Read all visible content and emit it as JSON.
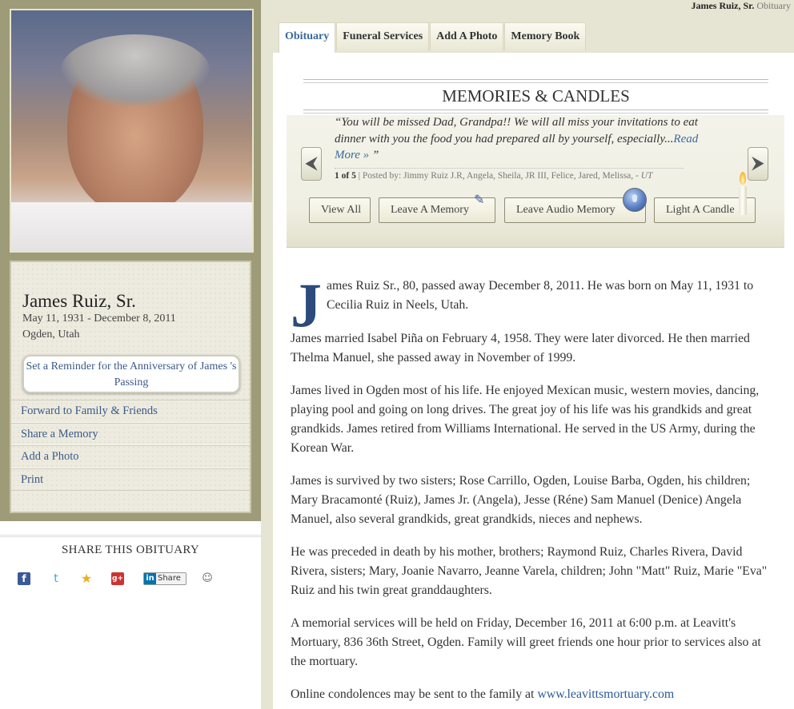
{
  "page": {
    "header_name": "James Ruiz, Sr.",
    "header_suffix": "Obituary"
  },
  "tabs": [
    {
      "label": "Obituary",
      "active": true
    },
    {
      "label": "Funeral Services",
      "active": false
    },
    {
      "label": "Add A Photo",
      "active": false
    },
    {
      "label": "Memory Book",
      "active": false
    }
  ],
  "profile": {
    "name": "James Ruiz, Sr.",
    "dates": "May 11, 1931 - December 8, 2011",
    "location": "Ogden, Utah",
    "reminder_label": "Set a Reminder for the Anniversary of James 's Passing"
  },
  "sidebar": {
    "links": [
      {
        "label": "Forward to Family & Friends"
      },
      {
        "label": "Share a Memory"
      },
      {
        "label": "Add a Photo"
      },
      {
        "label": "Print"
      }
    ]
  },
  "share": {
    "title": "SHARE THIS OBITUARY",
    "icons": [
      "facebook-icon",
      "twitter-icon",
      "favorite-star-icon",
      "google-plus-icon",
      "linkedin-share-icon",
      "reddit-icon"
    ],
    "linkedin_label": "Share",
    "fb_glyph": "f",
    "twitter_glyph": "t",
    "star_glyph": "★",
    "gplus_glyph": "g+",
    "linkedin_glyph": "in",
    "reddit_glyph": "☺"
  },
  "memories": {
    "title": "MEMORIES & CANDLES",
    "quote": "“You will be missed Dad, Grandpa!! We will all miss your invitations to eat dinner with you the food you had prepared all by yourself, especially...",
    "read_more": "Read More »",
    "quote_close": " ”",
    "counter": "1 of 5",
    "posted_by": " | Posted by: Jimmy Ruiz J.R, Angela, Sheila, JR III, Felice, Jared, Melissa, - ",
    "posted_loc": "UT",
    "prev_glyph": "⮜",
    "next_glyph": "⮞",
    "pen_glyph": "✎",
    "buttons": {
      "view_all": "View All",
      "leave_memory": "Leave A Memory",
      "leave_audio": "Leave Audio Memory",
      "light_candle": "Light A Candle"
    }
  },
  "obituary": {
    "dropcap": "J",
    "p1": "ames Ruiz Sr., 80, passed away December 8, 2011. He was born on May 11, 1931 to Cecilia Ruiz in Neels, Utah.",
    "p2": "James married Isabel Piña on February 4, 1958. They were later divorced. He then married Thelma Manuel, she passed away in November of 1999.",
    "p3": "James lived in Ogden most of his life. He enjoyed Mexican music, western movies, dancing, playing pool and going on long drives. The great joy of his life was his grandkids and great grandkids. James retired from Williams International. He served in the US Army, during the Korean War.",
    "p4": "James is survived by two sisters; Rose Carrillo, Ogden, Louise Barba, Ogden, his children; Mary Bracamonté (Ruiz), James Jr. (Angela), Jesse (Réne) Sam Manuel (Denice) Angela Manuel, also several grandkids, great grandkids, nieces and nephews.",
    "p5": "He was preceded in death by his mother, brothers; Raymond Ruiz, Charles Rivera, David Rivera, sisters; Mary, Joanie Navarro, Jeanne Varela, children; John \"Matt\" Ruiz, Marie \"Eva\" Ruiz and his twin great granddaughters.",
    "p6": "A memorial services will be held on Friday, December 16, 2011 at 6:00 p.m. at Leavitt's Mortuary, 836 36th Street, Ogden. Family will greet friends one hour prior to services also at the mortuary.",
    "p7_text": "Online condolences may be sent to the family at ",
    "p7_link": "www.leavittsmortuary.com"
  },
  "colors": {
    "sidebar_bg": "#9e9c78",
    "link": "#3a5a8a",
    "dropcap": "#2c4a7c",
    "content_bg": "#e6e4d2"
  }
}
